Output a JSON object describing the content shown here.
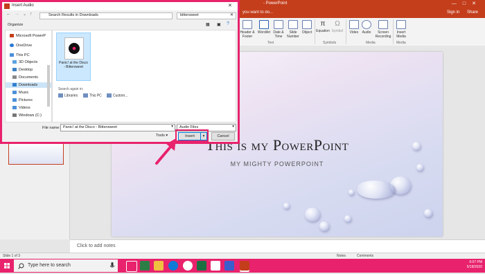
{
  "ppt": {
    "title": "- PowerPoint",
    "tell_me": "you want to do...",
    "sign_in": "Sign in",
    "share": "Share",
    "ribbon": [
      {
        "label": "Header & Footer"
      },
      {
        "label": "WordArt"
      },
      {
        "label": "Date & Time"
      },
      {
        "label": "Slide Number"
      },
      {
        "label": "Object"
      },
      {
        "label": "Equation"
      },
      {
        "label": "Symbol"
      },
      {
        "label": "Video"
      },
      {
        "label": "Audio"
      },
      {
        "label": "Screen Recording"
      },
      {
        "label": "Insert Media"
      }
    ],
    "groups": {
      "text": "Text",
      "symbols": "Symbols",
      "media": "Media",
      "media2": "Media"
    },
    "slide": {
      "title": "This is my PowerPoint",
      "subtitle": "MY MIGHTY POWERPOINT"
    },
    "notes_placeholder": "Click to add notes",
    "status": {
      "slide": "Slide 1 of 3",
      "notes": "Notes",
      "comments": "Comments"
    }
  },
  "dialog": {
    "title": "Insert Audio",
    "address": "Search Results in Downloads",
    "search_value": "bittersweet",
    "organize": "Organize",
    "nav": [
      {
        "label": "Microsoft PowerP",
        "color": "#c43e1c"
      },
      {
        "label": "OneDrive",
        "color": "#2b79d6"
      },
      {
        "label": "This PC",
        "color": "#4a90d9"
      },
      {
        "label": "3D Objects",
        "color": "#5ba3e0"
      },
      {
        "label": "Desktop",
        "color": "#3b82c4"
      },
      {
        "label": "Documents",
        "color": "#8a8a8a"
      },
      {
        "label": "Downloads",
        "color": "#2f7fd0"
      },
      {
        "label": "Music",
        "color": "#4a90d9"
      },
      {
        "label": "Pictures",
        "color": "#4a90d9"
      },
      {
        "label": "Videos",
        "color": "#4a90d9"
      },
      {
        "label": "Windows (C:)",
        "color": "#777777"
      }
    ],
    "file": {
      "name": "Panic! at the Disco - Bittersweet"
    },
    "search_again": "Search again in:",
    "search_locations": [
      "Libraries",
      "This PC",
      "Custom..."
    ],
    "file_name_label": "File name:",
    "file_name_value": "Panic! at the Disco - Bittersweet",
    "file_type": "Audio Files",
    "tools": "Tools",
    "insert": "Insert",
    "cancel": "Cancel"
  },
  "taskbar": {
    "search_placeholder": "Type here to search",
    "time": "6:07 PM",
    "date": "5/18/2020"
  },
  "colors": {
    "accent": "#e8226c",
    "ppt": "#c43e1c"
  }
}
